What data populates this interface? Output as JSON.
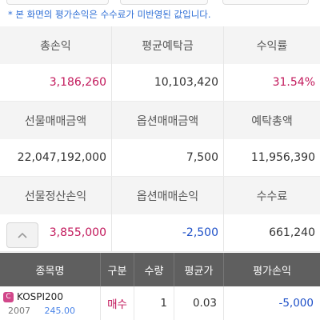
{
  "notice": "* 본 화면의 평가손익은 수수료가 미반영된 값입니다.",
  "summary": {
    "headers1": [
      "총손익",
      "평균예탁금",
      "수익률"
    ],
    "values1": [
      "3,186,260",
      "10,103,420",
      "31.54%"
    ],
    "headers2": [
      "선물매매금액",
      "옵션매매금액",
      "예탁총액"
    ],
    "values2": [
      "22,047,192,000",
      "7,500",
      "11,956,390"
    ],
    "headers3": [
      "선물정산손익",
      "옵션매매손익",
      "수수료"
    ],
    "values3": [
      "3,855,000",
      "-2,500",
      "661,240"
    ]
  },
  "scroll_up_icon": "chevron-up-icon",
  "table": {
    "columns": [
      "종목명",
      "구분",
      "수량",
      "평균가",
      "평가손익"
    ],
    "rows": [
      {
        "badge": "C",
        "name": "KOSPI200",
        "sub_left": "2007",
        "sub_right": "245.00",
        "side": "매수",
        "qty": "1",
        "avg": "0.03",
        "pnl": "-5,000"
      }
    ]
  },
  "colors": {
    "profit": "#c2185b",
    "loss": "#1e50c8",
    "notice": "#2f6fd6",
    "header_bg": "#5f5f5f"
  }
}
